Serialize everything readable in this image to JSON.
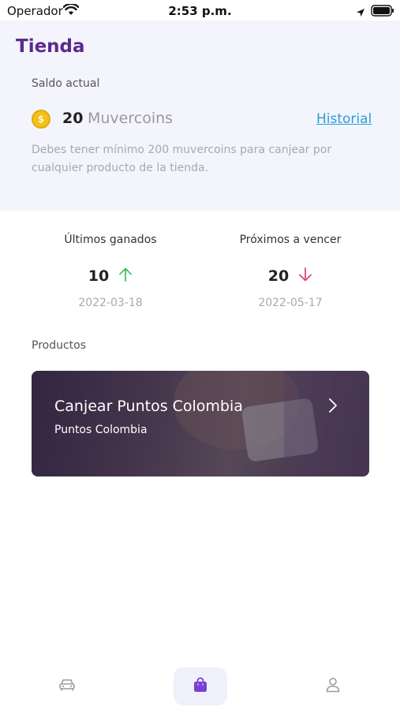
{
  "status_bar": {
    "carrier": "Operador",
    "time": "2:53 p.m."
  },
  "header": {
    "title": "Tienda",
    "saldo_label": "Saldo actual",
    "balance_value": "20",
    "balance_unit": "Muvercoins",
    "historial_link": "Historial",
    "info_text": "Debes tener mínimo 200 muvercoins para canjear por cualquier producto de la tienda."
  },
  "stats": {
    "earned": {
      "label": "Últimos ganados",
      "value": "10",
      "date": "2022-03-18",
      "trend": "up",
      "color": "#3cc36a"
    },
    "expiring": {
      "label": "Próximos a vencer",
      "value": "20",
      "date": "2022-05-17",
      "trend": "down",
      "color": "#e0457b"
    }
  },
  "products": {
    "label": "Productos",
    "items": [
      {
        "title": "Canjear Puntos Colombia",
        "subtitle": "Puntos Colombia"
      }
    ]
  },
  "tab_bar": {
    "tabs": [
      {
        "icon": "car-icon",
        "active": false
      },
      {
        "icon": "shopping-bag-icon",
        "active": true
      },
      {
        "icon": "user-icon",
        "active": false
      }
    ],
    "accent": "#7b3fd1"
  },
  "colors": {
    "title": "#5b2a8e",
    "link": "#2a9ed8",
    "panel_bg": "#f4f4fc",
    "coin": "#f2c21a"
  }
}
